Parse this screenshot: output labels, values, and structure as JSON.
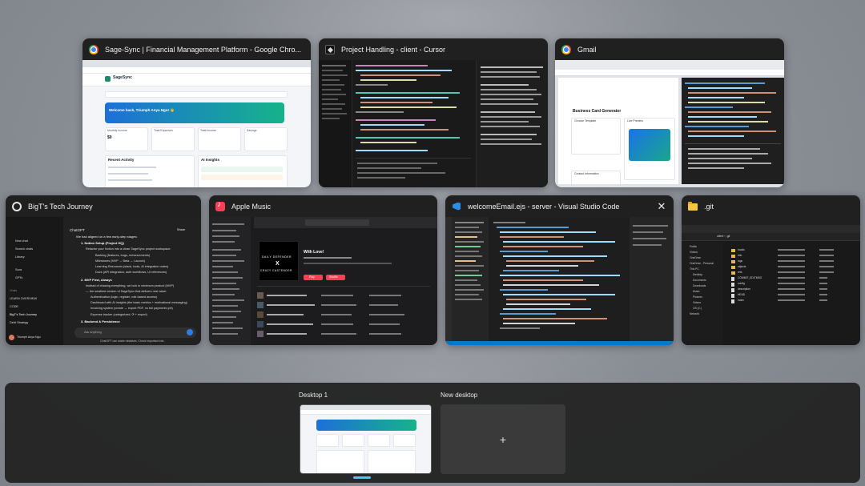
{
  "windows": [
    {
      "title": "Sage-Sync | Financial Management Platform - Google Chro...",
      "app": "chrome-icon",
      "thumb": {
        "brand": "SageSync",
        "welcome": "Welcome back, Triumph Anya Ngu! 👋",
        "cards": [
          "Monthly Income",
          "Total Expenses",
          "Total Income",
          "Savings"
        ],
        "value": "$0",
        "sections": [
          "Recent Activity",
          "AI Insights"
        ]
      }
    },
    {
      "title": "Project Handling - client - Cursor",
      "app": "cursor-icon"
    },
    {
      "title": "Gmail",
      "app": "chrome-icon",
      "thumb": {
        "heading": "Business Card Generator",
        "panels": [
          "Choose Template",
          "Live Preview",
          "Contact Information"
        ]
      }
    },
    {
      "title": "BigT's Tech Journey",
      "app": "openai-icon",
      "thumb": {
        "header": "ChatGPT",
        "share": "Share",
        "sidebar": [
          "New chat",
          "Search chats",
          "Library",
          "Sora",
          "GPTs",
          "Chats",
          "LEARN OVERVIEW",
          "CODE",
          "BigT's Tech Journey",
          "Debt Strategy"
        ],
        "user": "Triumph Anya Ngu",
        "lines": [
          "We had aligned on a few early-step stages:",
          "1. Notion Setup (Project HQ)",
          "Refactor your Notion into a clean SageSync project workspace:",
          "Backlog (features, bugs, enhancements)",
          "Milestones (MVP → Beta → Launch)",
          "Learning Resources (stack, tools, AI integration notes)",
          "Docs (API integration, auth workflows, UI references)",
          "2. MVP First, Always",
          "Instead of chasing everything, we lock in minimum product (MVP)",
          "— the smallest version of SageSync that delivers real value:",
          "Authentication (login, register, role-based access)",
          "Dashboard with AI insights (the basic metrics + motivational messaging)",
          "Invoicing system (create → export PDF, no full payments yet)",
          "Expense tracker (categorized, ⟳ + export)",
          "3. Backend & Persistence"
        ],
        "input": "Ask anything",
        "footer": "ChatGPT can make mistakes. Check important info."
      }
    },
    {
      "title": "Apple Music",
      "app": "music-icon",
      "thumb": {
        "album": "DAILY DEFENDER",
        "album_sub": "CRAZY CASTENDER",
        "heading": "With Love!",
        "play": "Play",
        "shuffle": "Shuffle"
      }
    },
    {
      "title": "welcomeEmail.ejs - server - Visual Studio Code",
      "app": "vscode-icon",
      "close": "✕"
    },
    {
      "title": ".git",
      "app": "folder-icon",
      "thumb": {
        "crumb": "client › .git",
        "files": [
          "hooks",
          "info",
          "logs",
          "objects",
          "refs",
          "COMMIT_EDITMSG",
          "config",
          "description",
          "HEAD",
          "index"
        ],
        "nav": [
          "Public",
          "Videos",
          "OneDrive",
          "OneDrive - Personal",
          "This PC",
          "Desktop",
          "Documents",
          "Downloads",
          "Music",
          "Pictures",
          "Videos",
          "OS (C:)",
          "Network"
        ]
      }
    }
  ],
  "desktops": {
    "current": "Desktop 1",
    "new": "New desktop",
    "plus": "+"
  }
}
